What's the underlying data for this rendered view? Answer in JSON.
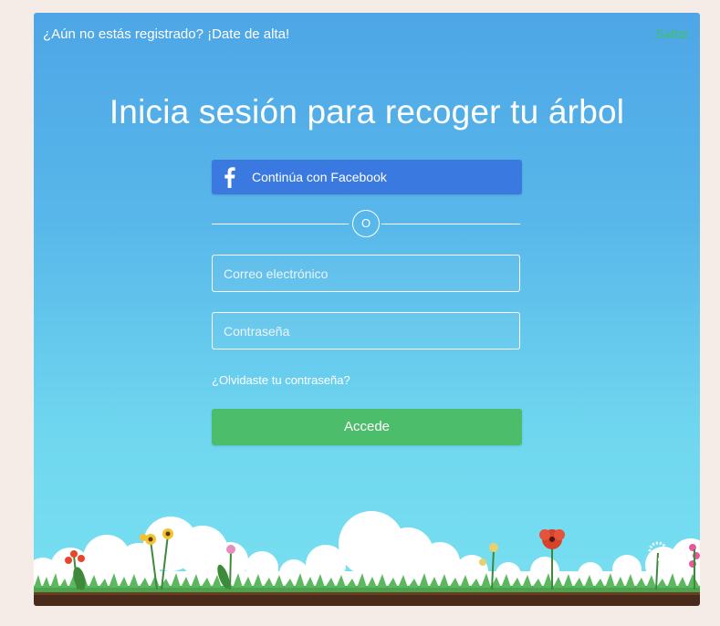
{
  "topbar": {
    "signup_text": "¿Aún no estás registrado? ¡Date de alta!",
    "skip_label": "Saltar"
  },
  "login": {
    "title": "Inicia sesión para recoger tu árbol",
    "facebook_label": "Continúa con Facebook",
    "facebook_icon": "facebook-icon",
    "divider_text": "O",
    "email_placeholder": "Correo electrónico",
    "password_placeholder": "Contraseña",
    "forgot_label": "¿Olvidaste tu contraseña?",
    "submit_label": "Accede"
  },
  "colors": {
    "background": "#f5ece8",
    "sky_top": "#4ea6e6",
    "sky_bottom": "#78e0f0",
    "facebook": "#3a7ae0",
    "submit": "#4cbd6b",
    "skip": "#3fbf6a",
    "grass": "#4aa64e",
    "soil": "#4a2a1a"
  }
}
